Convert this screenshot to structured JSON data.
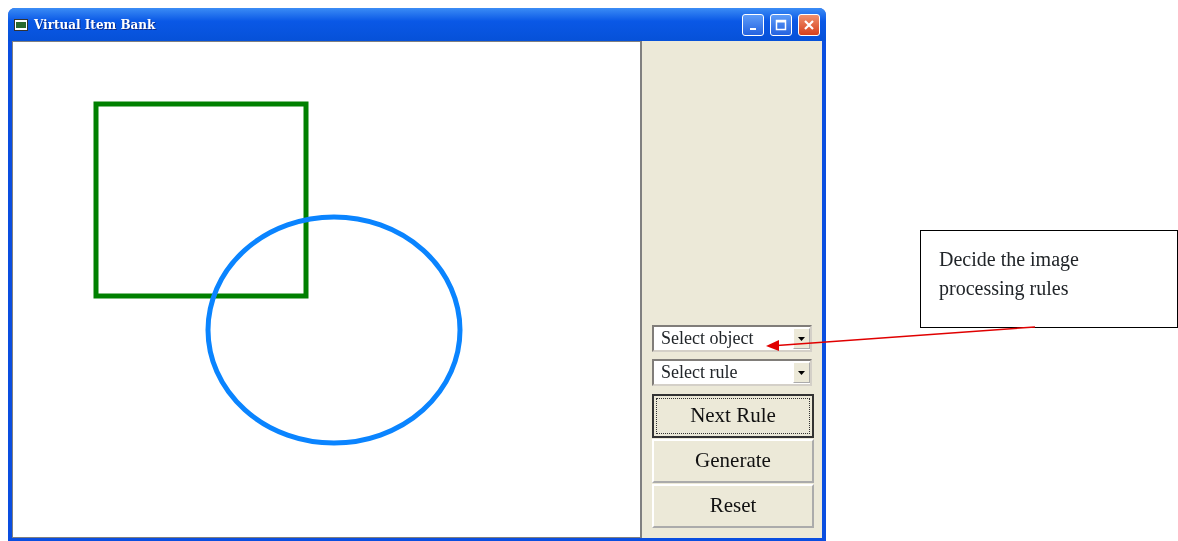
{
  "window": {
    "title": "Virtual Item Bank"
  },
  "canvas": {
    "shapes": [
      {
        "kind": "square",
        "color": "#008000"
      },
      {
        "kind": "circle",
        "color": "#0a84ff"
      }
    ]
  },
  "panel": {
    "dropdowns": [
      {
        "value": "Select object"
      },
      {
        "value": "Select rule"
      }
    ],
    "buttons": [
      {
        "label": "Next Rule",
        "focused": true
      },
      {
        "label": "Generate",
        "focused": false
      },
      {
        "label": "Reset",
        "focused": false
      }
    ]
  },
  "callout": {
    "text": "Decide the image processing rules"
  }
}
